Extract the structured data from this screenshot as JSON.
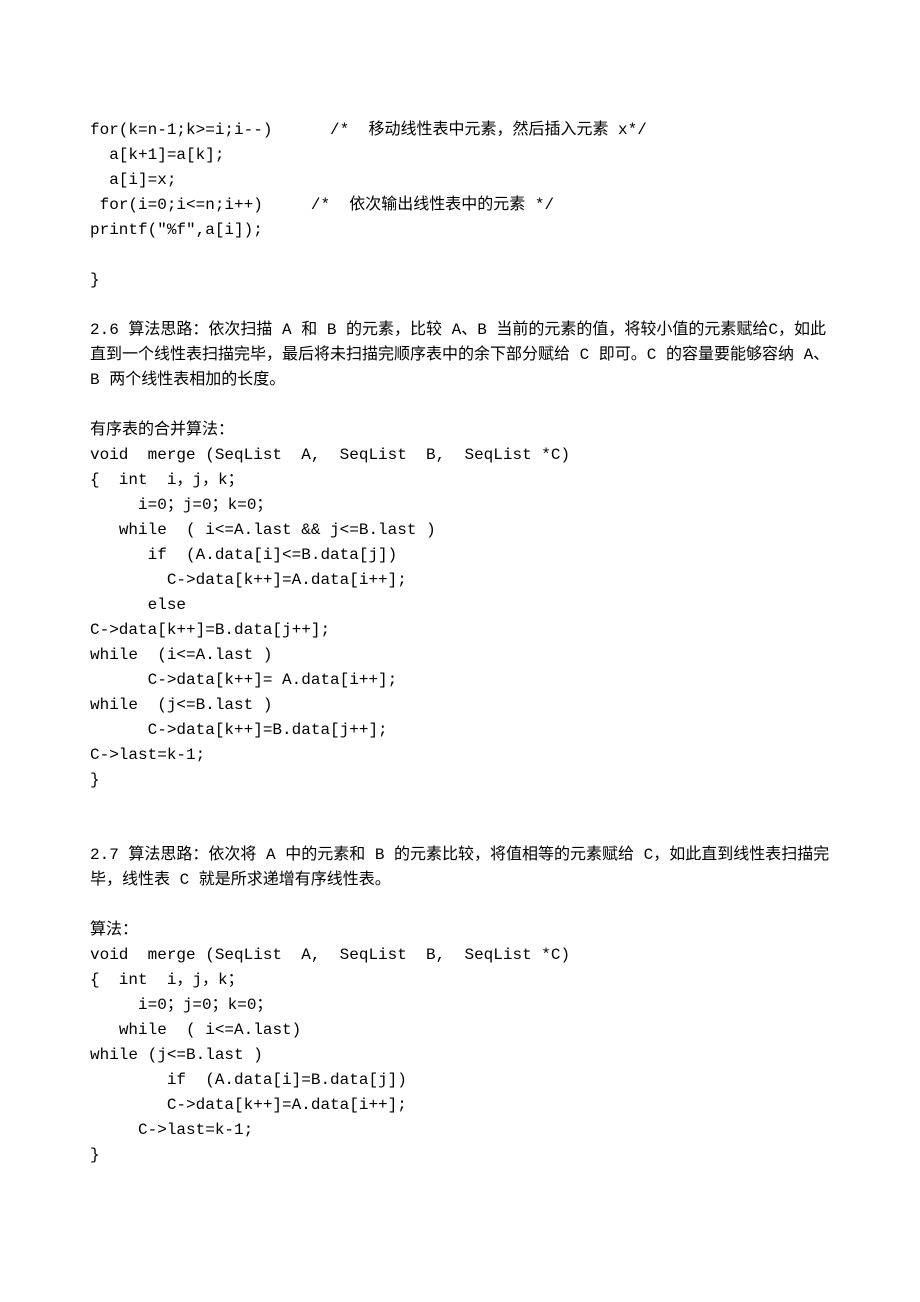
{
  "lines": [
    "for(k=n-1;k>=i;i--)      /*  移动线性表中元素，然后插入元素 x*/",
    "  a[k+1]=a[k];",
    "  a[i]=x;",
    " for(i=0;i<=n;i++)     /*  依次输出线性表中的元素 */",
    "printf(\"%f\",a[i]);",
    "",
    "}",
    "",
    "2.6 算法思路：依次扫描 A 和 B 的元素，比较 A、B 当前的元素的值，将较小值的元素赋给C，如此直到一个线性表扫描完毕，最后将未扫描完顺序表中的余下部分赋给 C 即可。C 的容量要能够容纳 A、B 两个线性表相加的长度。",
    "",
    "有序表的合并算法：",
    "void  merge (SeqList  A,  SeqList  B,  SeqList *C)",
    "{  int  i，j，k；",
    "     i=0；j=0；k=0；",
    "   while  ( i<=A.last && j<=B.last )",
    "      if  (A.data[i]<=B.data[j])",
    "        C->data[k++]=A.data[i++];",
    "      else",
    "C->data[k++]=B.data[j++];",
    "while  (i<=A.last )",
    "      C->data[k++]= A.data[i++];",
    "while  (j<=B.last )",
    "      C->data[k++]=B.data[j++];",
    "C->last=k-1;",
    "}",
    "",
    "",
    "2.7 算法思路：依次将 A 中的元素和 B 的元素比较，将值相等的元素赋给 C，如此直到线性表扫描完毕，线性表 C 就是所求递增有序线性表。",
    "",
    "算法：",
    "void  merge (SeqList  A,  SeqList  B,  SeqList *C)",
    "{  int  i，j，k；",
    "     i=0；j=0；k=0；",
    "   while  ( i<=A.last)",
    "while (j<=B.last )",
    "        if  (A.data[i]=B.data[j])",
    "        C->data[k++]=A.data[i++];",
    "     C->last=k-1;",
    "}"
  ]
}
